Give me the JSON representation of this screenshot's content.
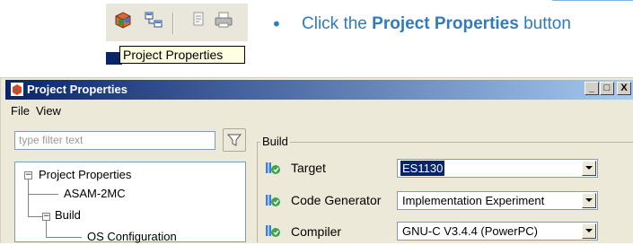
{
  "toolbar": {
    "icons": [
      "project-properties-icon",
      "connect-icon",
      "document-icon",
      "print-icon"
    ],
    "tooltip": "Project Properties"
  },
  "instruction": {
    "bullet": "•",
    "prefix": "Click the ",
    "emphasis": "Project Properties",
    "suffix": " button"
  },
  "window": {
    "title": "Project Properties",
    "caption_buttons": {
      "minimize": "_",
      "maximize": "□",
      "close": "X"
    },
    "menu": [
      "File",
      "View"
    ]
  },
  "filter": {
    "placeholder": "type filter text"
  },
  "tree": {
    "items": [
      {
        "label": "Project Properties",
        "expander": "−"
      },
      {
        "label": "ASAM-2MC"
      },
      {
        "label": "Build",
        "expander": "−"
      },
      {
        "label": "OS Configuration"
      }
    ]
  },
  "build_group": {
    "label": "Build",
    "rows": [
      {
        "label": "Target",
        "value": "ES1130",
        "selected": true
      },
      {
        "label": "Code Generator",
        "value": "Implementation Experiment"
      },
      {
        "label": "Compiler",
        "value": "GNU-C V3.4.4 (PowerPC)"
      }
    ]
  },
  "colors": {
    "instruction_blue": "#2f7bbf",
    "titlebar_start": "#0a246a",
    "titlebar_end": "#a6caf0",
    "selection": "#0a246a"
  }
}
